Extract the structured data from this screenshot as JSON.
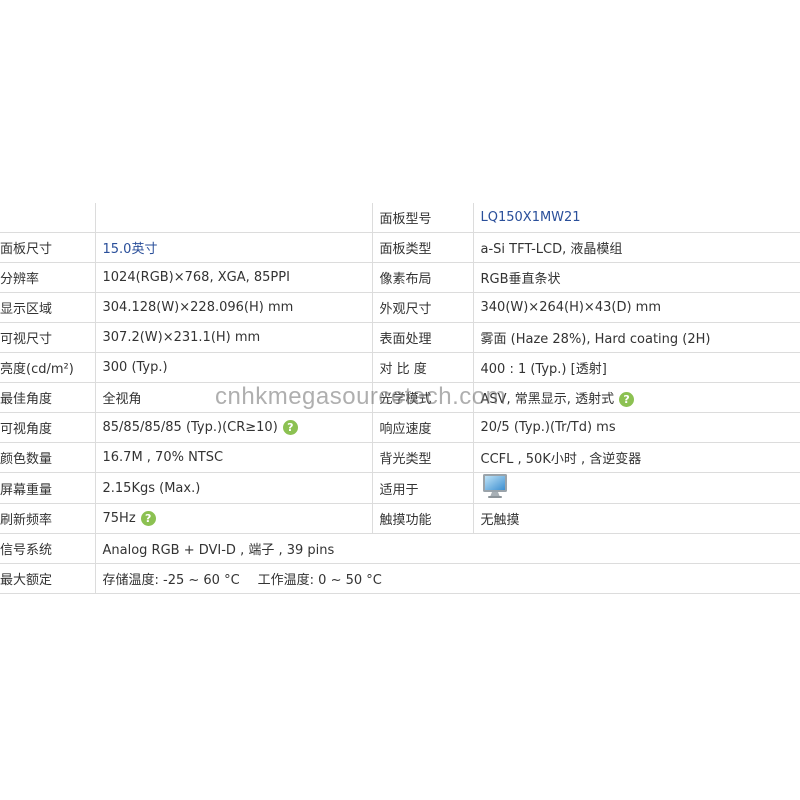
{
  "watermark": "cnhkmegasourcetech.com",
  "rows": [
    {
      "k1": "",
      "v1": "",
      "k2": "面板型号",
      "v2": "LQ150X1MW21"
    },
    {
      "k1": "面板尺寸",
      "v1": "15.0英寸",
      "k2": "面板类型",
      "v2": "a-Si TFT-LCD, 液晶模组"
    },
    {
      "k1": "分辨率",
      "v1": "1024(RGB)×768, XGA, 85PPI",
      "k2": "像素布局",
      "v2": "RGB垂直条状"
    },
    {
      "k1": "显示区域",
      "v1": "304.128(W)×228.096(H) mm",
      "k2": "外观尺寸",
      "v2": "340(W)×264(H)×43(D) mm"
    },
    {
      "k1": "可视尺寸",
      "v1": "307.2(W)×231.1(H) mm",
      "k2": "表面处理",
      "v2": "雾面 (Haze 28%), Hard coating (2H)"
    },
    {
      "k1": "亮度(cd/m²)",
      "v1": "300 (Typ.)",
      "k2": "对 比 度",
      "v2": "400 : 1 (Typ.) [透射]"
    },
    {
      "k1": "最佳角度",
      "v1": "全视角",
      "k2": "光学模式",
      "v2": "ASV, 常黑显示, 透射式"
    },
    {
      "k1": "可视角度",
      "v1": "85/85/85/85 (Typ.)(CR≥10)",
      "k2": "响应速度",
      "v2": "20/5 (Typ.)(Tr/Td) ms"
    },
    {
      "k1": "颜色数量",
      "v1": "16.7M , 70% NTSC",
      "k2": "背光类型",
      "v2": "CCFL , 50K小时 , 含逆变器"
    },
    {
      "k1": "屏幕重量",
      "v1": "2.15Kgs (Max.)",
      "k2": "适用于",
      "v2": ""
    },
    {
      "k1": "刷新频率",
      "v1": "75Hz",
      "k2": "触摸功能",
      "v2": "无触摸"
    },
    {
      "k1": "信号系统",
      "v1": "Analog RGB + DVI-D , 端子 , 39 pins"
    },
    {
      "k1": "最大额定",
      "v1a": "存储温度: -25 ~ 60 °C",
      "v1b": "工作温度: 0 ~ 50 °C"
    }
  ],
  "help_glyph": "?",
  "icons": {
    "help": "help-icon",
    "monitor": "monitor-icon"
  },
  "colors": {
    "link": "#2a4f9a",
    "help": "#8cc152",
    "border": "#dcdcdc"
  }
}
